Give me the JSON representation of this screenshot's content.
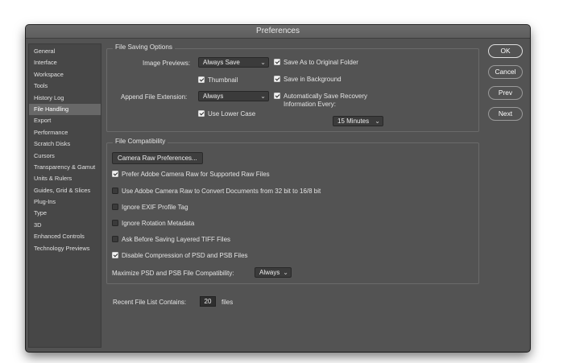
{
  "window": {
    "title": "Preferences"
  },
  "sidebar": {
    "items": [
      {
        "label": "General"
      },
      {
        "label": "Interface"
      },
      {
        "label": "Workspace"
      },
      {
        "label": "Tools"
      },
      {
        "label": "History Log"
      },
      {
        "label": "File Handling",
        "selected": true
      },
      {
        "label": "Export"
      },
      {
        "label": "Performance"
      },
      {
        "label": "Scratch Disks"
      },
      {
        "label": "Cursors"
      },
      {
        "label": "Transparency & Gamut"
      },
      {
        "label": "Units & Rulers"
      },
      {
        "label": "Guides, Grid & Slices"
      },
      {
        "label": "Plug-Ins"
      },
      {
        "label": "Type"
      },
      {
        "label": "3D"
      },
      {
        "label": "Enhanced Controls"
      },
      {
        "label": "Technology Previews"
      }
    ]
  },
  "file_saving": {
    "legend": "File Saving Options",
    "image_previews_label": "Image Previews:",
    "image_previews_value": "Always Save",
    "thumbnail_label": "Thumbnail",
    "thumbnail_checked": true,
    "append_ext_label": "Append File Extension:",
    "append_ext_value": "Always",
    "lower_case_label": "Use Lower Case",
    "lower_case_checked": true,
    "save_original_label": "Save As to Original Folder",
    "save_original_checked": true,
    "save_background_label": "Save in Background",
    "save_background_checked": true,
    "auto_save_label_1": "Automatically Save Recovery",
    "auto_save_label_2": "Information Every:",
    "auto_save_checked": true,
    "auto_save_interval": "15 Minutes"
  },
  "compat": {
    "legend": "File Compatibility",
    "camera_raw_button": "Camera Raw Preferences...",
    "options": [
      {
        "label": "Prefer Adobe Camera Raw for Supported Raw Files",
        "checked": true
      },
      {
        "label": "Use Adobe Camera Raw to Convert Documents from 32 bit to 16/8 bit",
        "checked": false
      },
      {
        "label": "Ignore EXIF Profile Tag",
        "checked": false
      },
      {
        "label": "Ignore Rotation Metadata",
        "checked": false
      },
      {
        "label": "Ask Before Saving Layered TIFF Files",
        "checked": false
      },
      {
        "label": "Disable Compression of PSD and PSB Files",
        "checked": true
      }
    ],
    "maximize_label": "Maximize PSD and PSB File Compatibility:",
    "maximize_value": "Always"
  },
  "recent": {
    "label": "Recent File List Contains:",
    "value": "20",
    "unit": "files"
  },
  "buttons": {
    "ok": "OK",
    "cancel": "Cancel",
    "prev": "Prev",
    "next": "Next"
  },
  "colors": {
    "dialog_bg": "#535353",
    "sidebar_bg": "#474747",
    "selected_bg": "#686868"
  }
}
